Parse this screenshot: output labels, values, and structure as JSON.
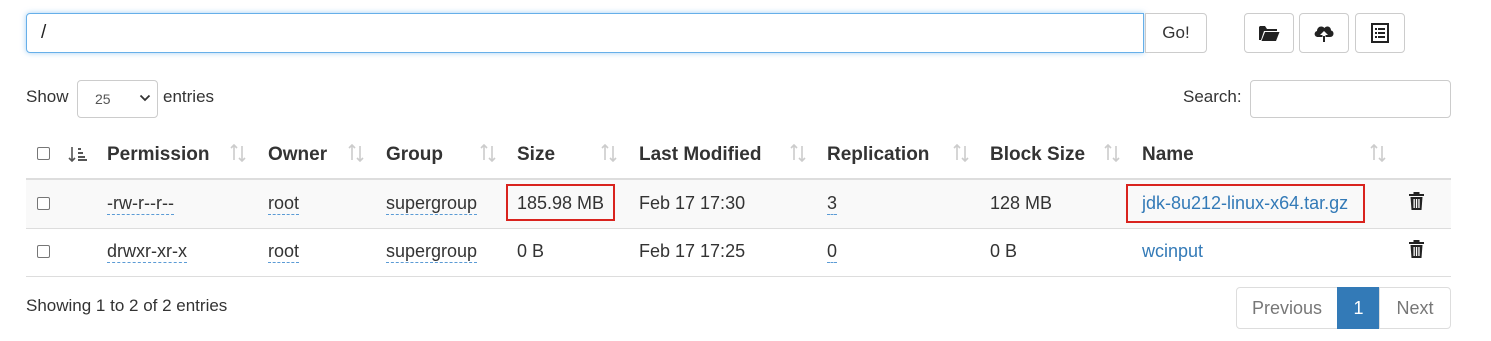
{
  "toolbar": {
    "path_value": "/",
    "go_label": "Go!",
    "buttons": [
      "folder-open-icon",
      "cloud-upload-icon",
      "list-alt-icon"
    ]
  },
  "controls": {
    "show_label": "Show",
    "page_size": "25",
    "entries_label": "entries",
    "search_label": "Search:",
    "search_value": ""
  },
  "table": {
    "columns": [
      "Permission",
      "Owner",
      "Group",
      "Size",
      "Last Modified",
      "Replication",
      "Block Size",
      "Name"
    ],
    "rows": [
      {
        "permission": "-rw-r--r--",
        "owner": "root",
        "group": "supergroup",
        "size": "185.98 MB",
        "modified": "Feb 17 17:30",
        "replication": "3",
        "block_size": "128 MB",
        "name": "jdk-8u212-linux-x64.tar.gz"
      },
      {
        "permission": "drwxr-xr-x",
        "owner": "root",
        "group": "supergroup",
        "size": "0 B",
        "modified": "Feb 17 17:25",
        "replication": "0",
        "block_size": "0 B",
        "name": "wcinput"
      }
    ]
  },
  "footer": {
    "info": "Showing 1 to 2 of 2 entries",
    "previous": "Previous",
    "current_page": "1",
    "next": "Next"
  },
  "colors": {
    "link": "#337ab7",
    "highlight_box": "#d9231e",
    "active_page": "#337ab7"
  }
}
